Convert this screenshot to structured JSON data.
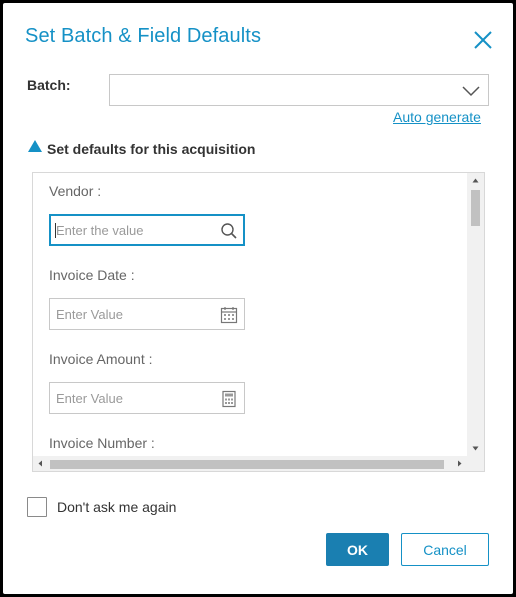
{
  "dialog": {
    "title": "Set Batch & Field Defaults",
    "close_icon": "close-icon"
  },
  "batch": {
    "label": "Batch:",
    "value": "",
    "auto_generate": "Auto generate"
  },
  "section": {
    "label": "Set defaults for this acquisition",
    "expanded": true
  },
  "fields": [
    {
      "label": "Vendor :",
      "placeholder": "Enter the value",
      "icon": "search-icon"
    },
    {
      "label": "Invoice Date :",
      "placeholder": "Enter Value",
      "icon": "calendar-icon"
    },
    {
      "label": "Invoice Amount :",
      "placeholder": "Enter Value",
      "icon": "calculator-icon"
    },
    {
      "label": "Invoice Number :"
    }
  ],
  "dont_ask": {
    "label": "Don't ask me again",
    "checked": false
  },
  "buttons": {
    "ok": "OK",
    "cancel": "Cancel"
  },
  "colors": {
    "accent": "#1591c6",
    "primary_button": "#1a7fb1"
  }
}
